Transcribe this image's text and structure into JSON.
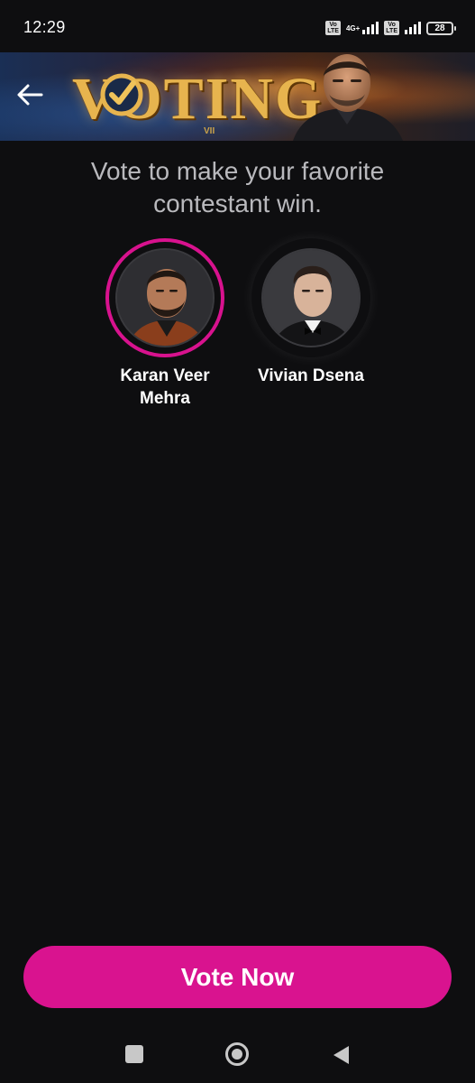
{
  "status_bar": {
    "time": "12:29",
    "network_label": "4G+",
    "volte_label": "Vo LTE",
    "battery_level": "28"
  },
  "header": {
    "banner_title": "VOTING",
    "banner_subtitle": "VII",
    "back_icon": "arrow-left-icon"
  },
  "main": {
    "headline": "Vote to make your favorite contestant win.",
    "contestants": [
      {
        "name": "Karan Veer Mehra",
        "selected": true
      },
      {
        "name": "Vivian Dsena",
        "selected": false
      }
    ]
  },
  "footer": {
    "vote_button_label": "Vote Now"
  },
  "nav_bar": {
    "icons": [
      "recents-icon",
      "home-icon",
      "back-triangle-icon"
    ]
  },
  "colors": {
    "background": "#0e0e10",
    "accent": "#d9138f",
    "banner_gold": "#e7b44e",
    "headline_text": "#b9b9bd"
  }
}
